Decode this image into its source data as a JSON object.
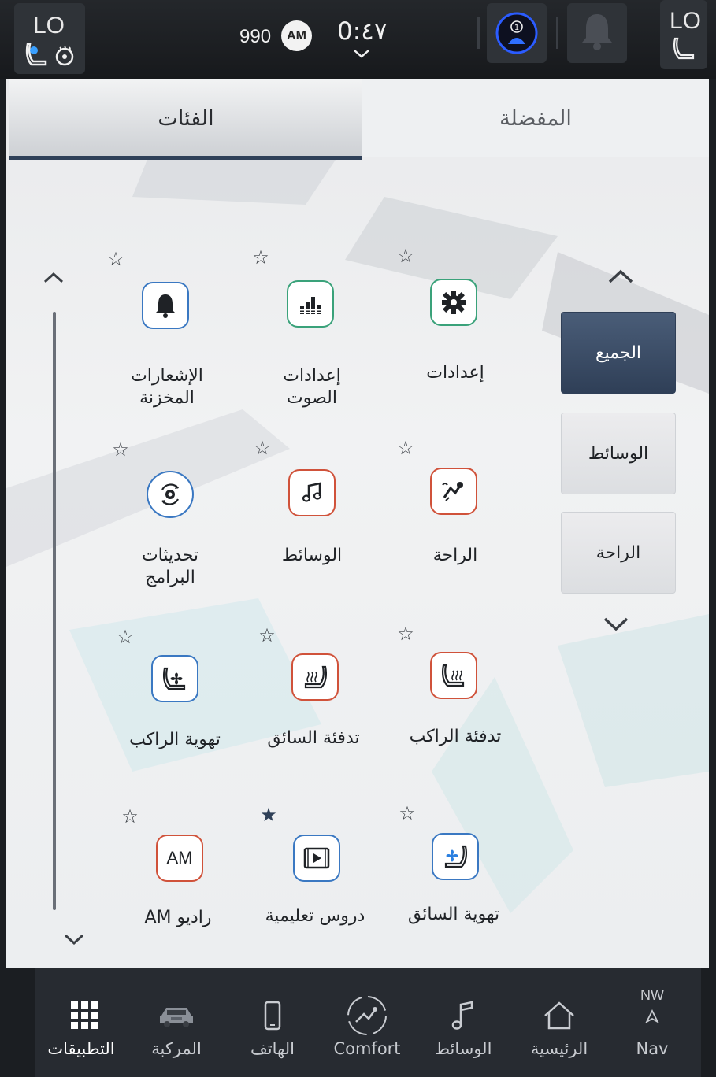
{
  "status_bar": {
    "left_temp": "LO",
    "right_temp": "LO",
    "frequency": "990",
    "band": "AM",
    "clock": "0:٤٧",
    "icons": [
      "seat-fan-icon",
      "steering-heat-icon",
      "driver-profile-icon",
      "bell-icon",
      "seat-icon"
    ]
  },
  "tabs": {
    "categories": "الفئات",
    "favorites": "المفضلة"
  },
  "categories": [
    {
      "label": "الجميع",
      "active": true
    },
    {
      "label": "الوسائط",
      "active": false
    },
    {
      "label": "الراحة",
      "active": false
    }
  ],
  "apps": [
    {
      "label": "إعدادات",
      "icon": "gear-icon",
      "favorite": false,
      "color": "#3aa27a"
    },
    {
      "label": "إعدادات\nالصوت",
      "icon": "equalizer-icon",
      "favorite": false,
      "color": "#3aa27a"
    },
    {
      "label": "الإشعارات\nالمخزنة",
      "icon": "bell-icon",
      "favorite": false,
      "color": "#3a78c2"
    },
    {
      "label": "الراحة",
      "icon": "comfort-icon",
      "favorite": false,
      "color": "#d0523a"
    },
    {
      "label": "الوسائط",
      "icon": "music-note-icon",
      "favorite": false,
      "color": "#d0523a"
    },
    {
      "label": "تحديثات\nالبرامج",
      "icon": "software-update-icon",
      "favorite": false,
      "color": "#3a78c2"
    },
    {
      "label": "تدفئة الراكب",
      "icon": "heated-seat-icon",
      "favorite": false,
      "color": "#d0523a"
    },
    {
      "label": "تدفئة السائق",
      "icon": "heated-seat-icon",
      "favorite": false,
      "color": "#d0523a"
    },
    {
      "label": "تهوية الراكب",
      "icon": "ventilated-seat-icon",
      "favorite": false,
      "color": "#3a78c2"
    },
    {
      "label": "تهوية السائق",
      "icon": "ventilated-seat-icon",
      "favorite": false,
      "color": "#3a78c2"
    },
    {
      "label": "دروس تعليمية",
      "icon": "video-play-icon",
      "favorite": true,
      "color": "#3a78c2"
    },
    {
      "label": "راديو AM",
      "icon": "am-radio-icon",
      "favorite": false,
      "color": "#d0523a"
    }
  ],
  "am_icon_text": "AM",
  "bottom_nav": {
    "compass": "NW",
    "items": [
      {
        "label": "Nav",
        "icon": "nav-arrow-icon"
      },
      {
        "label": "الرئيسية",
        "icon": "home-icon"
      },
      {
        "label": "الوسائط",
        "icon": "music-note-icon"
      },
      {
        "label": "Comfort",
        "icon": "comfort-icon"
      },
      {
        "label": "الهاتف",
        "icon": "phone-icon"
      },
      {
        "label": "المركبة",
        "icon": "vehicle-icon"
      },
      {
        "label": "التطبيقات",
        "icon": "apps-grid-icon",
        "active": true
      }
    ]
  }
}
